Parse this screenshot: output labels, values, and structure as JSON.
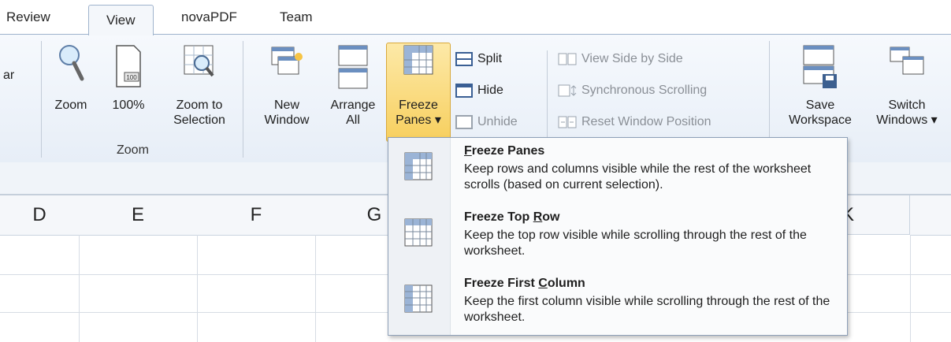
{
  "tabs": [
    {
      "label": "Review"
    },
    {
      "label": "View"
    },
    {
      "label": "novaPDF"
    },
    {
      "label": "Team"
    }
  ],
  "ribbon": {
    "cut_label": "ar",
    "zoom_group": {
      "zoom": "Zoom",
      "hundred": "100%",
      "hundred_icon_text": "100",
      "zoom_to_selection_1": "Zoom to",
      "zoom_to_selection_2": "Selection",
      "group_label": "Zoom"
    },
    "window_group": {
      "new_window_1": "New",
      "new_window_2": "Window",
      "arrange_all_1": "Arrange",
      "arrange_all_2": "All",
      "freeze_panes_1": "Freeze",
      "freeze_panes_2": "Panes",
      "split": "Split",
      "hide": "Hide",
      "unhide": "Unhide",
      "view_side_by_side": "View Side by Side",
      "synchronous_scrolling": "Synchronous Scrolling",
      "reset_window_position": "Reset Window Position",
      "save_workspace_1": "Save",
      "save_workspace_2": "Workspace",
      "switch_windows_1": "Switch",
      "switch_windows_2": "Windows"
    }
  },
  "columns": [
    "D",
    "E",
    "F",
    "G",
    "K"
  ],
  "menu": {
    "items": [
      {
        "title_pre": "",
        "title_u": "F",
        "title_post": "reeze Panes",
        "desc": "Keep rows and columns visible while the rest of the worksheet scrolls (based on current selection)."
      },
      {
        "title_pre": "Freeze Top ",
        "title_u": "R",
        "title_post": "ow",
        "desc": "Keep the top row visible while scrolling through the rest of the worksheet."
      },
      {
        "title_pre": "Freeze First ",
        "title_u": "C",
        "title_post": "olumn",
        "desc": "Keep the first column visible while scrolling through the rest of the worksheet."
      }
    ]
  },
  "colors": {
    "accent_active": "#f7cf5e",
    "ribbon_border": "#9fb3cc"
  }
}
